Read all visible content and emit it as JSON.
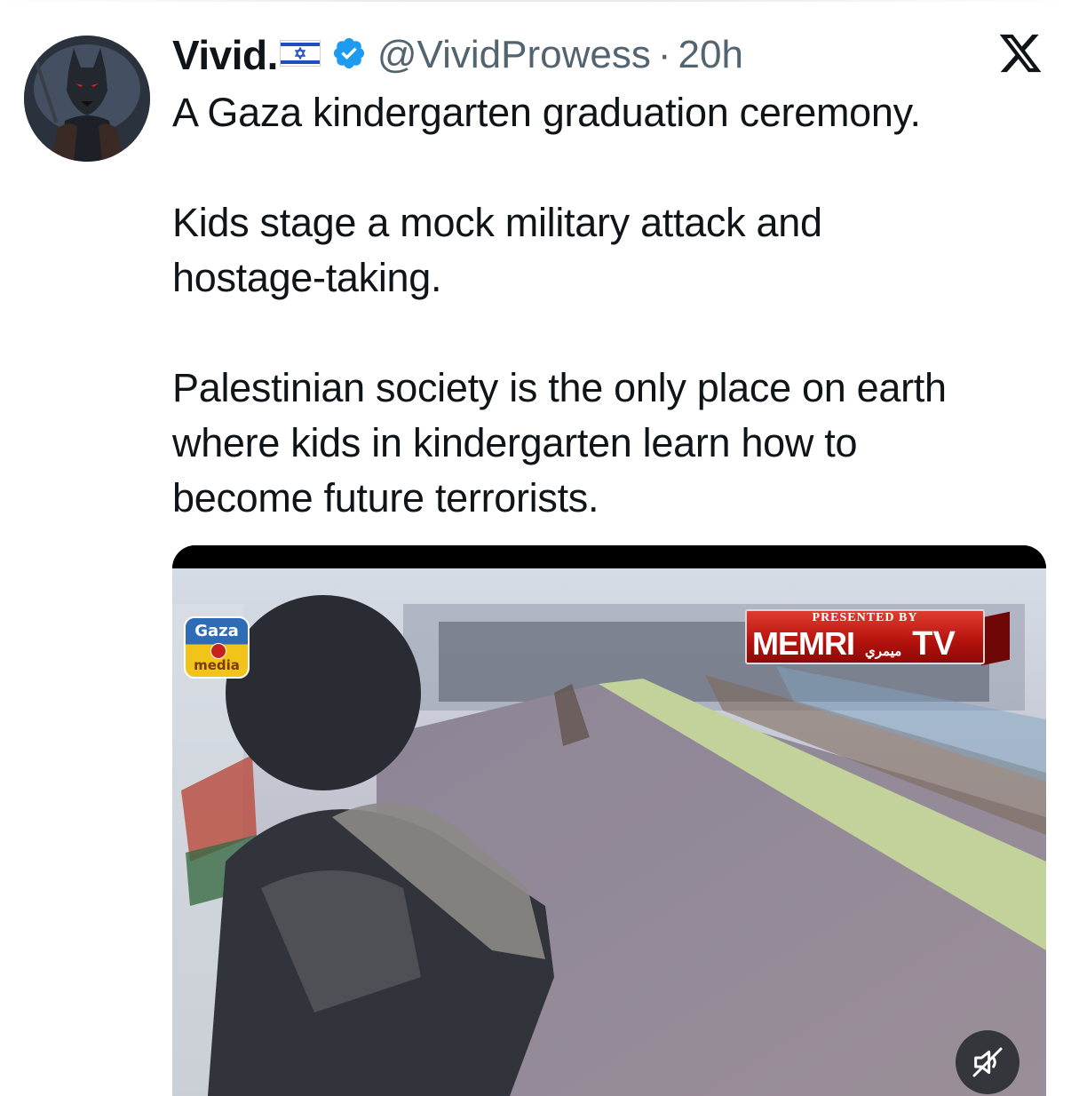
{
  "author": {
    "display_name": "Vivid.",
    "flag_icon": "israel-flag-icon",
    "verified_icon": "verified-badge-icon",
    "handle": "@VividProwess",
    "separator": "·",
    "time": "20h"
  },
  "platform": {
    "logo_icon": "x-logo-icon"
  },
  "tweet": {
    "paragraphs": [
      "A Gaza kindergarten graduation ceremony.",
      "Kids stage a mock military attack and\nhostage-taking.",
      "Palestinian society is the only place on earth\nwhere kids in kindergarten learn how to\nbecome future terrorists."
    ]
  },
  "media": {
    "type": "video",
    "gaza_logo": {
      "line1": "Gaza",
      "line2": "media"
    },
    "memri_logo": {
      "presented": "PRESENTED BY",
      "brand": "MEMRI",
      "arabic": "ميمري",
      "tv": "TV"
    },
    "mute_icon": "speaker-muted-icon"
  },
  "colors": {
    "text": "#0f1419",
    "secondary": "#536471",
    "verified": "#1d9bf0",
    "memri_red": "#c81a12"
  }
}
